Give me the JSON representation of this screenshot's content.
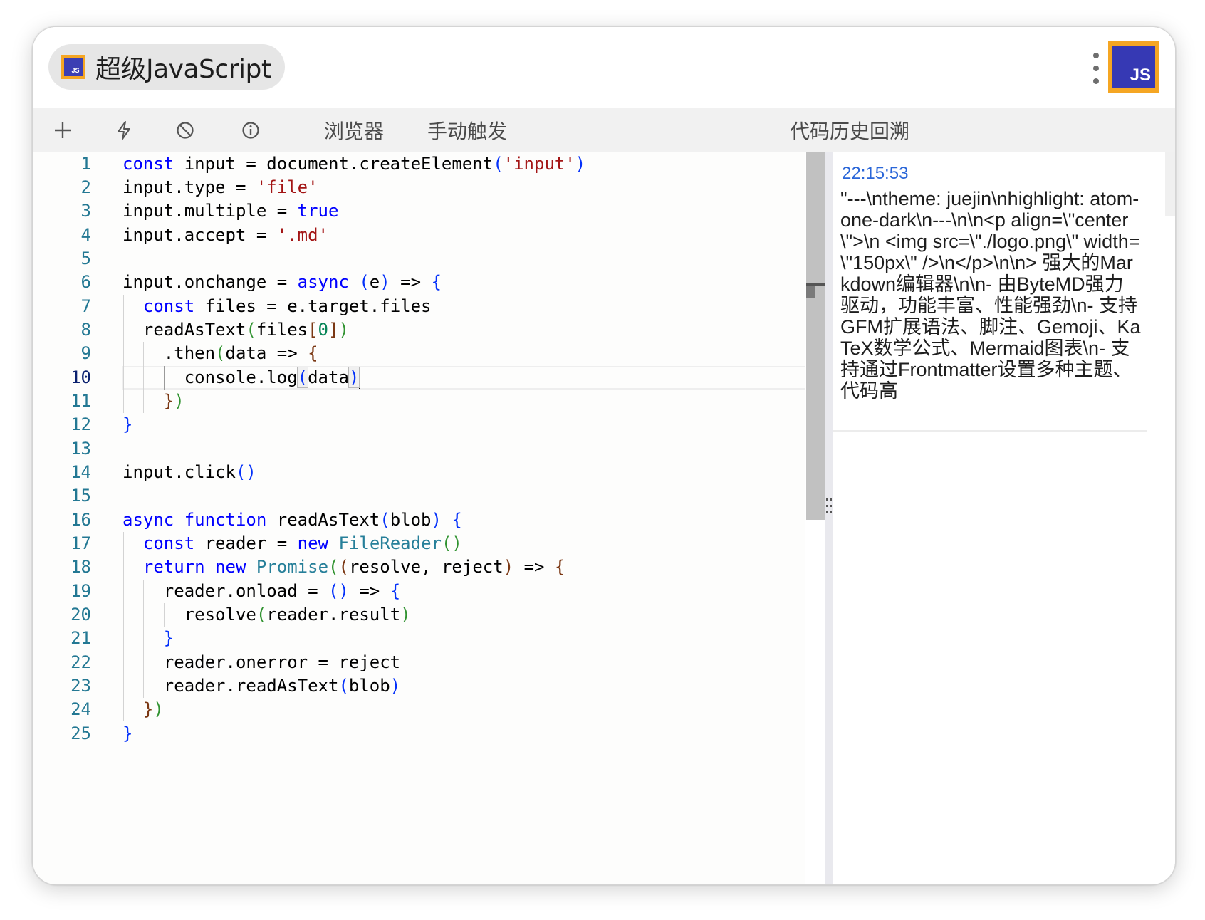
{
  "app": {
    "title": "超级JavaScript",
    "icon_label": "JS",
    "menu_icon": "more-vertical-icon",
    "ext_icon_label": "JS"
  },
  "toolbar": {
    "add_icon": "plus-icon",
    "run_icon": "lightning-icon",
    "clear_icon": "ban-icon",
    "info_icon": "info-icon",
    "browser_label": "浏览器",
    "manual_trigger_label": "手动触发",
    "history_label": "代码历史回溯"
  },
  "editor": {
    "active_line": 10,
    "line_numbers": [
      "1",
      "2",
      "3",
      "4",
      "5",
      "6",
      "7",
      "8",
      "9",
      "10",
      "11",
      "12",
      "13",
      "14",
      "15",
      "16",
      "17",
      "18",
      "19",
      "20",
      "21",
      "22",
      "23",
      "24",
      "25"
    ]
  },
  "history": {
    "entries": [
      {
        "time": "22:15:53",
        "text": "\"---\\ntheme: juejin\\nhighlight: atom-one-dark\\n---\\n\\n<p align=\\\"center\\\">\\n <img src=\\\"./logo.png\\\" width=\\\"150px\\\" />\\n</p>\\n\\n> 强大的Markdown编辑器\\n\\n- 由ByteMD强力驱动，功能丰富、性能强劲\\n- 支持GFM扩展语法、脚注、Gemoji、KaTeX数学公式、Mermaid图表\\n- 支持通过Frontmatter设置多种主题、代码高"
      }
    ]
  },
  "colors": {
    "keyword": "#0000ff",
    "string": "#a31515",
    "class": "#267f99",
    "line_number": "#237893",
    "timestamp": "#2a66d8",
    "icon_border": "#f5a623",
    "icon_bg": "#3639b4"
  }
}
